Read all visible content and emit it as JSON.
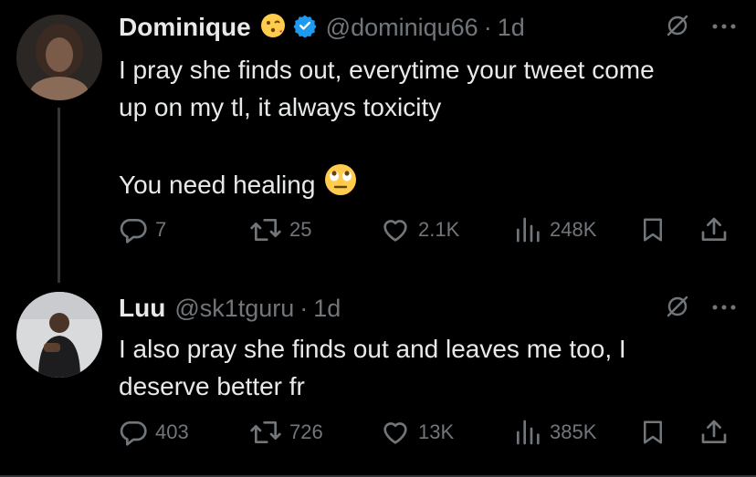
{
  "tweets": [
    {
      "name": "Dominique",
      "name_emoji": "kissing-face-emoji",
      "verified": true,
      "handle": "@dominiqu66",
      "separator": "·",
      "time": "1d",
      "text_lines": [
        "I pray she finds out, everytime your tweet come",
        "up on my tl, it always toxicity",
        "",
        "You need healing"
      ],
      "text_emoji": "eye-roll-emoji",
      "metrics": {
        "replies": "7",
        "retweets": "25",
        "likes": "2.1K",
        "views": "248K"
      }
    },
    {
      "name": "Luu",
      "handle": "@sk1tguru",
      "separator": "·",
      "time": "1d",
      "text_lines": [
        "I also pray she finds out and leaves me too, I",
        "deserve better fr"
      ],
      "metrics": {
        "replies": "403",
        "retweets": "726",
        "likes": "13K",
        "views": "385K"
      }
    }
  ],
  "colors": {
    "background": "#000000",
    "text": "#e7e9ea",
    "muted": "#71767b",
    "verified": "#1d9bf0",
    "divider": "#333639"
  }
}
